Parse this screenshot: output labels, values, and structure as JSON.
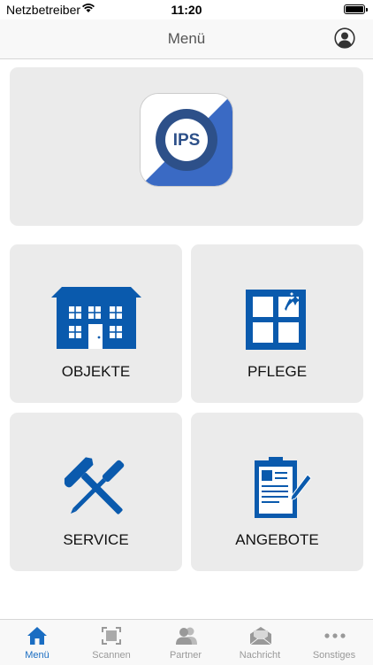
{
  "status_bar": {
    "carrier": "Netzbetreiber",
    "time": "11:20",
    "battery_level": 1.0
  },
  "nav": {
    "title": "Menü",
    "profile_icon": "person-circle-icon"
  },
  "logo": {
    "text": "IPS",
    "colors": {
      "primary": "#3a6ac4",
      "ring": "#2d5089"
    }
  },
  "tiles": [
    {
      "label": "OBJEKTE",
      "icon": "house-icon"
    },
    {
      "label": "PFLEGE",
      "icon": "window-cleaning-icon"
    },
    {
      "label": "SERVICE",
      "icon": "tools-icon"
    },
    {
      "label": "ANGEBOTE",
      "icon": "clipboard-icon"
    }
  ],
  "tabs": [
    {
      "label": "Menü",
      "icon": "home-icon",
      "active": true
    },
    {
      "label": "Scannen",
      "icon": "scan-icon",
      "active": false
    },
    {
      "label": "Partner",
      "icon": "partner-icon",
      "active": false
    },
    {
      "label": "Nachricht",
      "icon": "mail-icon",
      "active": false
    },
    {
      "label": "Sonstiges",
      "icon": "more-icon",
      "active": false
    }
  ],
  "colors": {
    "accent": "#0a5aad",
    "tab_active": "#1a6dc2",
    "tab_inactive": "#999999",
    "card": "#ebebeb"
  }
}
